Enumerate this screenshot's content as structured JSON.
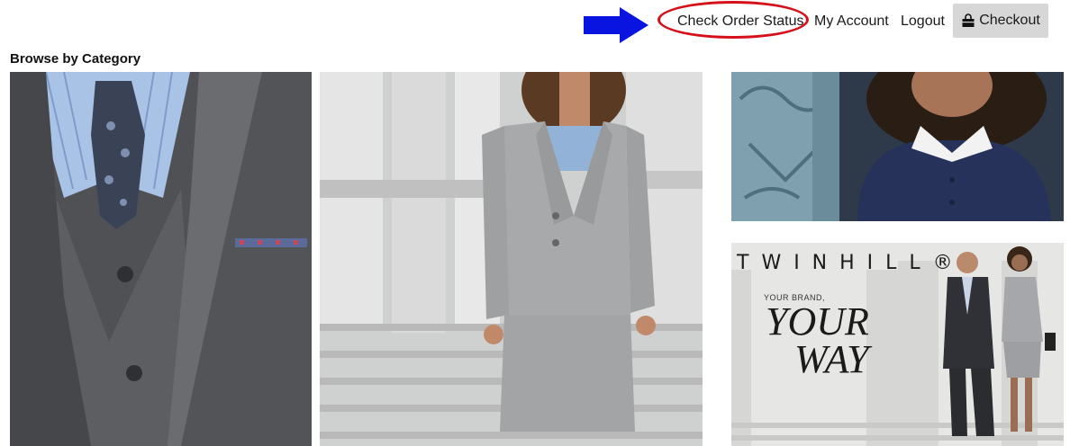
{
  "nav": {
    "check_order_status": "Check Order Status",
    "my_account": "My Account",
    "logout": "Logout",
    "checkout": "Checkout"
  },
  "annotations": {
    "arrow_color": "#0a14e0",
    "circle_color": "#d6101a"
  },
  "section": {
    "title": "Browse by Category"
  },
  "brand_tile": {
    "logo": "TWINHILL®",
    "tagline_small": "YOUR BRAND,",
    "tagline_big_1": "YOUR",
    "tagline_big_2": "WAY"
  },
  "icons": {
    "checkout": "shopping-bag-icon"
  }
}
